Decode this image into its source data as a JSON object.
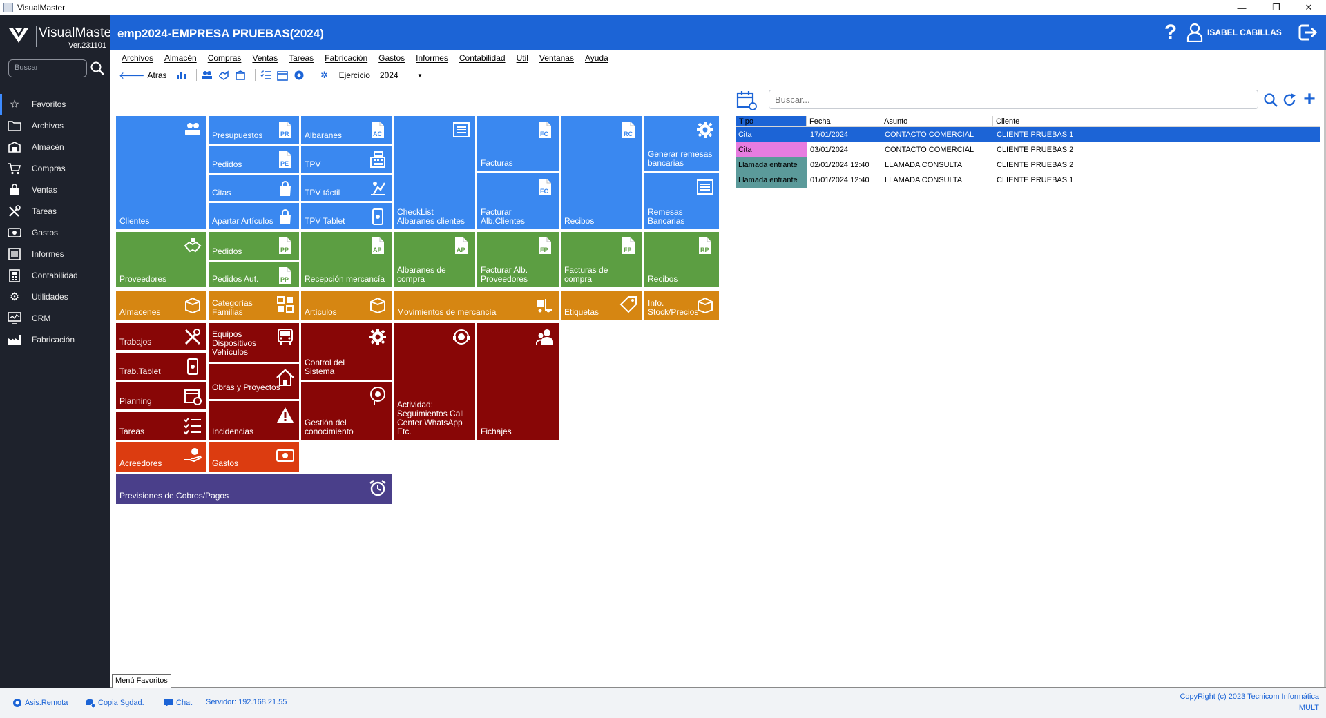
{
  "window": {
    "title": "VisualMaster",
    "controls": {
      "minimize": "—",
      "restore": "❐",
      "close": "✕"
    }
  },
  "brand": {
    "name": "VisualMaster",
    "version": "Ver.231101"
  },
  "sidebar": {
    "search_placeholder": "Buscar",
    "items": [
      {
        "label": "Favoritos",
        "icon": "star-icon"
      },
      {
        "label": "Archivos",
        "icon": "folder-icon"
      },
      {
        "label": "Almacén",
        "icon": "warehouse-icon"
      },
      {
        "label": "Compras",
        "icon": "cart-icon"
      },
      {
        "label": "Ventas",
        "icon": "bag-icon"
      },
      {
        "label": "Tareas",
        "icon": "tools-icon"
      },
      {
        "label": "Gastos",
        "icon": "money-icon"
      },
      {
        "label": "Informes",
        "icon": "report-icon"
      },
      {
        "label": "Contabilidad",
        "icon": "ledger-icon"
      },
      {
        "label": "Utilidades",
        "icon": "gears-icon"
      },
      {
        "label": "CRM",
        "icon": "monitor-icon"
      },
      {
        "label": "Fabricación",
        "icon": "factory-icon"
      }
    ]
  },
  "header": {
    "title": "emp2024-EMPRESA PRUEBAS(2024)",
    "help": "?",
    "user": "ISABEL CABILLAS"
  },
  "menubar": [
    "Archivos",
    "Almacén",
    "Compras",
    "Ventas",
    "Tareas",
    "Fabricación",
    "Gastos",
    "Informes",
    "Contabilidad",
    "Util",
    "Ventanas",
    "Ayuda"
  ],
  "toolbar": {
    "back": "Atras",
    "ejercicio_label": "Ejercicio",
    "ejercicio_value": "2024"
  },
  "tiles": {
    "clientes": "Clientes",
    "presupuestos": "Presupuestos",
    "pedidos_v": "Pedidos",
    "citas": "Citas",
    "apartar": "Apartar Artículos",
    "albaranes": "Albaranes",
    "tpv": "TPV",
    "tpv_tactil": "TPV táctil",
    "tpv_tablet": "TPV Tablet",
    "checklist": "CheckList Albaranes clientes",
    "facturas": "Facturas",
    "facturar_alb": "Facturar Alb.Clientes",
    "recibos_v": "Recibos",
    "generar_remesas": "Generar remesas bancarias",
    "remesas": "Remesas Bancarias",
    "proveedores": "Proveedores",
    "pedidos_c": "Pedidos",
    "pedidos_aut": "Pedidos Aut.",
    "recepcion": "Recepción mercancía",
    "albaranes_compra": "Albaranes de compra",
    "facturar_alb_prov": "Facturar Alb. Proveedores",
    "facturas_compra": "Facturas de compra",
    "recibos_c": "Recibos",
    "almacenes": "Almacenes",
    "categorias": "Categorías Familias",
    "articulos": "Artículos",
    "movimientos": "Movimientos de mercancía",
    "etiquetas": "Etiquetas",
    "info_stock": "Info. Stock/Precios",
    "trabajos": "Trabajos",
    "equipos": "Equipos Dispositivos Vehículos",
    "control": "Control del Sistema",
    "actividad": "Actividad: Seguimientos Call Center WhatsApp Etc.",
    "fichajes": "Fichajes",
    "trab_tablet": "Trab.Tablet",
    "obras": "Obras y Proyectos",
    "planning": "Planning",
    "tareas": "Tareas",
    "incidencias": "Incidencias",
    "gestion": "Gestión del conocimiento",
    "acreedores": "Acreedores",
    "gastos": "Gastos",
    "previsiones": "Previsiones de Cobros/Pagos"
  },
  "doc_badges": {
    "pr": "PR",
    "pe": "PE",
    "ac": "AC",
    "fc": "FC",
    "rc": "RC",
    "pp": "PP",
    "ap": "AP",
    "fp": "FP",
    "rp": "RP"
  },
  "agenda": {
    "search_placeholder": "Buscar...",
    "columns": [
      "Tipo",
      "Fecha",
      "Asunto",
      "Cliente"
    ],
    "rows": [
      {
        "tipo": "Cita",
        "fecha": "17/01/2024",
        "asunto": "CONTACTO COMERCIAL",
        "cliente": "CLIENTE PRUEBAS 1",
        "color": "#1c64d6"
      },
      {
        "tipo": "Cita",
        "fecha": "03/01/2024",
        "asunto": "CONTACTO COMERCIAL",
        "cliente": "CLIENTE PRUEBAS 2",
        "color": "#e77ce0"
      },
      {
        "tipo": "Llamada entrante",
        "fecha": "02/01/2024 12:40",
        "asunto": "LLAMADA CONSULTA",
        "cliente": "CLIENTE PRUEBAS 2",
        "color": "#5b9a9a"
      },
      {
        "tipo": "Llamada entrante",
        "fecha": "01/01/2024 12:40",
        "asunto": "LLAMADA CONSULTA",
        "cliente": "CLIENTE PRUEBAS 1",
        "color": "#5b9a9a"
      }
    ]
  },
  "bottom": {
    "tab": "Menú Favoritos",
    "asis": "Asis.Remota",
    "copia": "Copia Sgdad.",
    "chat": "Chat",
    "servidor": "Servidor: 192.168.21.55",
    "copyright": "CopyRight (c) 2023 Tecnicom Informática",
    "mult": "MULT"
  },
  "colors": {
    "accent": "#1c64d6",
    "sidebar": "#1e222c",
    "blue_tile": "#3a88f0",
    "green_tile": "#5c9e42",
    "orange_tile": "#d68612",
    "darkred_tile": "#880606",
    "redorange_tile": "#dc3c10",
    "purple_tile": "#4a3f8a"
  }
}
